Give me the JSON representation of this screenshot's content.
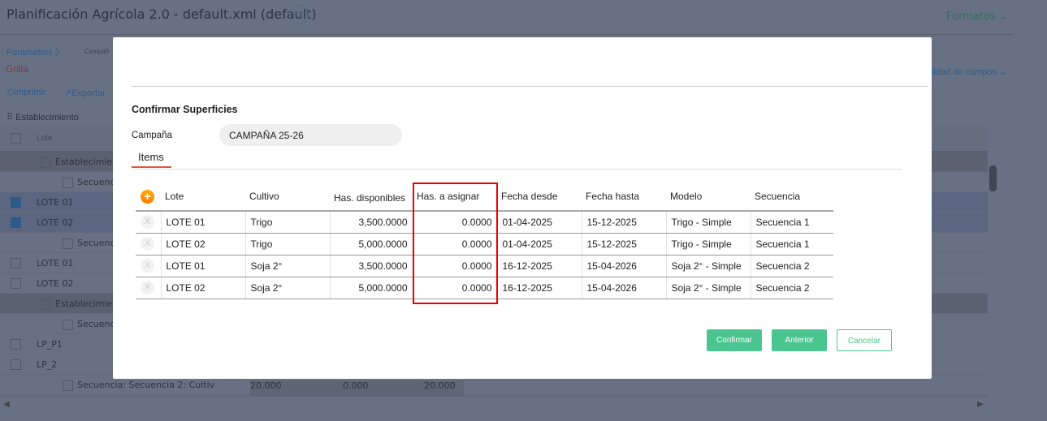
{
  "background": {
    "title": "Planificación Agrícola 2.0 - default.xml (default)",
    "formatos": "Formatos",
    "parametros": "Parámetros",
    "campana_crumb": "Campañ",
    "grilla": "Grilla",
    "imprimir": "Imprimir",
    "exportar": "Exportar",
    "visibilidad": "lidad de campos",
    "establecimiento": "Establecimiento",
    "col_lote": "Lote",
    "rows": [
      {
        "text": "Establecimier",
        "indent": 2,
        "checked": false,
        "dark": true
      },
      {
        "text": "Secuenc",
        "indent": 3,
        "checked": false,
        "dark": false
      },
      {
        "text": "LOTE 01",
        "indent": 1,
        "checked": true,
        "dark": false,
        "sel": true
      },
      {
        "text": "LOTE 02",
        "indent": 1,
        "checked": true,
        "dark": false,
        "sel": true
      },
      {
        "text": "Secuenc",
        "indent": 3,
        "checked": false,
        "dark": false
      },
      {
        "text": "LOTE 01",
        "indent": 1,
        "checked": false,
        "dark": false
      },
      {
        "text": "LOTE 02",
        "indent": 1,
        "checked": false,
        "dark": false
      },
      {
        "text": "Establecimier",
        "indent": 2,
        "checked": false,
        "dark": true
      },
      {
        "text": "Secuenc",
        "indent": 3,
        "checked": false,
        "dark": false
      },
      {
        "text": "LP_P1",
        "indent": 1,
        "checked": false,
        "dark": false
      },
      {
        "text": "LP_2",
        "indent": 1,
        "checked": false,
        "dark": false
      },
      {
        "text": "Secuencia: Secuencia 2: Cultiv",
        "indent": 3,
        "checked": false,
        "dark": false
      }
    ],
    "last_values": [
      "20.000",
      "0.000",
      "20.000"
    ]
  },
  "modal": {
    "title": "Confirmar Superficies",
    "campana_label": "Campaña",
    "campana_value": "CAMPAÑA 25-26",
    "tab": "Items",
    "columns": [
      "Lote",
      "Cultivo",
      "Has. disponibles",
      "Has. a asignar",
      "Fecha desde",
      "Fecha hasta",
      "Modelo",
      "Secuencia"
    ],
    "rows": [
      [
        "LOTE 01",
        "Trigo",
        "3,500.0000",
        "0.0000",
        "01-04-2025",
        "15-12-2025",
        "Trigo - Simple",
        "Secuencia 1"
      ],
      [
        "LOTE 02",
        "Trigo",
        "5,000.0000",
        "0.0000",
        "01-04-2025",
        "15-12-2025",
        "Trigo - Simple",
        "Secuencia 1"
      ],
      [
        "LOTE 01",
        "Soja 2°",
        "3,500.0000",
        "0.0000",
        "16-12-2025",
        "15-04-2026",
        "Soja 2° - Simple",
        "Secuencia 2"
      ],
      [
        "LOTE 02",
        "Soja 2°",
        "5,000.0000",
        "0.0000",
        "16-12-2025",
        "15-04-2026",
        "Soja 2° - Simple",
        "Secuencia 2"
      ]
    ],
    "buttons": {
      "confirm": "Confirmar",
      "previous": "Anterior",
      "cancel": "Cancelar"
    }
  }
}
